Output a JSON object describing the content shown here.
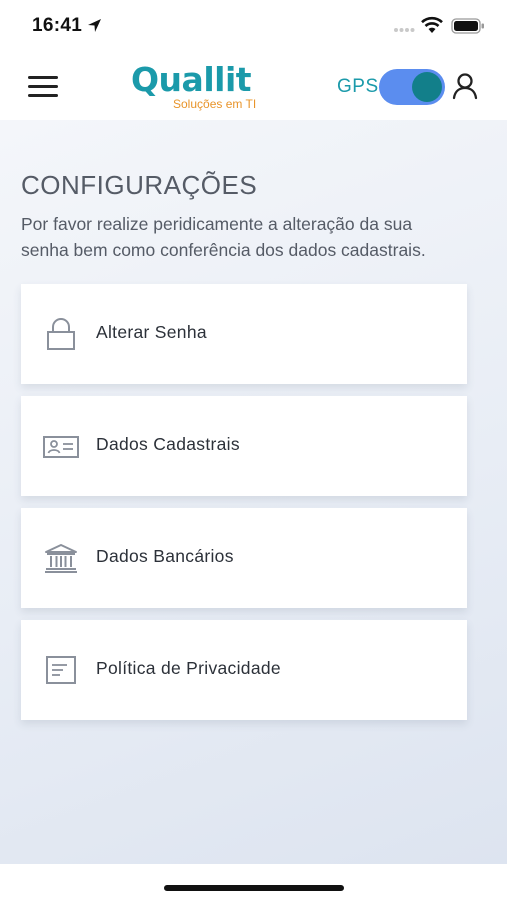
{
  "status_bar": {
    "time": "16:41",
    "icons": [
      "location-arrow-icon",
      "cellular-dots-icon",
      "wifi-icon",
      "battery-icon"
    ]
  },
  "header": {
    "menu_icon": "hamburger-menu-icon",
    "logo_text": "Quallit",
    "logo_subtitle": "Soluções em TI",
    "gps_label": "GPS",
    "gps_enabled": true,
    "user_icon": "user-icon",
    "colors": {
      "brand": "#1b9aaa",
      "accent": "#e8942a",
      "toggle": "#5b8def"
    }
  },
  "main": {
    "title": "CONFIGURAÇÕES",
    "description": "Por favor realize peridicamente a alteração da sua senha bem como conferência dos dados cadastrais.",
    "items": [
      {
        "label": "Alterar Senha",
        "icon": "lock-icon"
      },
      {
        "label": "Dados Cadastrais",
        "icon": "id-card-icon"
      },
      {
        "label": "Dados Bancários",
        "icon": "bank-icon"
      },
      {
        "label": "Política de Privacidade",
        "icon": "document-icon"
      }
    ]
  }
}
